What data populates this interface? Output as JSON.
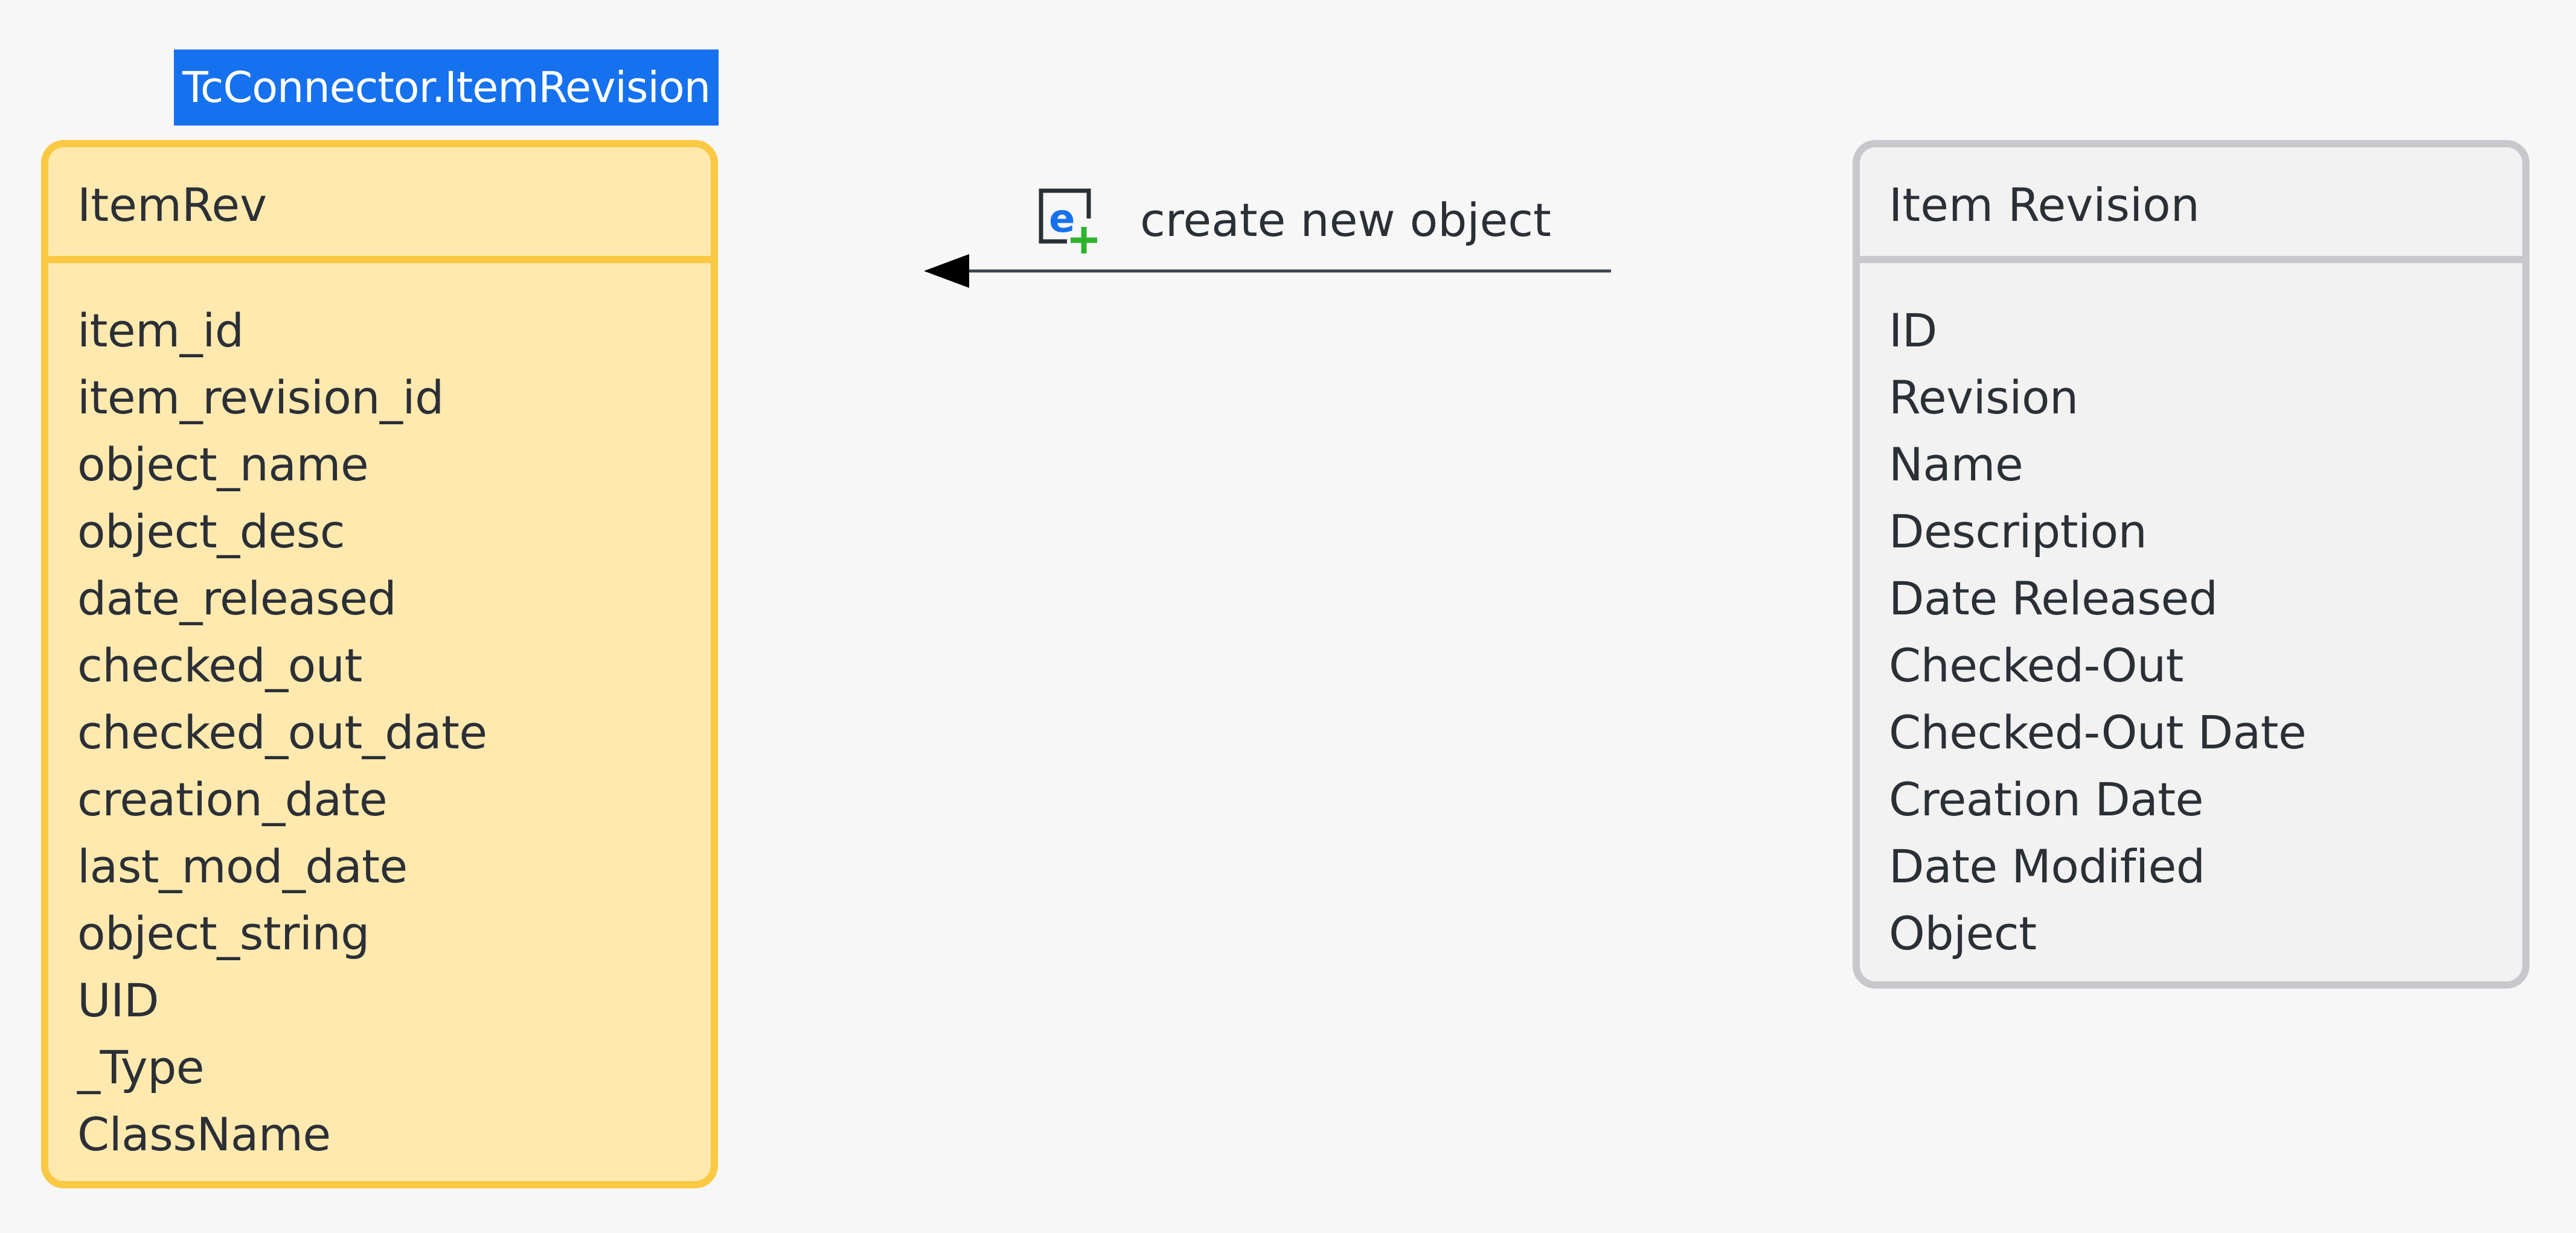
{
  "source_entity": {
    "tag": "TcConnector.ItemRevision",
    "title": "ItemRev",
    "fields": [
      "item_id",
      "item_revision_id",
      "object_name",
      "object_desc",
      "date_released",
      "checked_out",
      "checked_out_date",
      "creation_date",
      "last_mod_date",
      "object_string",
      "UID",
      "_Type",
      "ClassName"
    ]
  },
  "target_entity": {
    "title": "Item Revision",
    "fields": [
      "ID",
      "Revision",
      "Name",
      "Description",
      "Date Released",
      "Checked-Out",
      "Checked-Out Date",
      "Creation Date",
      "Date Modified",
      "Object"
    ]
  },
  "connector": {
    "label": "create new object",
    "icon": "create-object-icon",
    "direction": "right-to-left"
  },
  "colors": {
    "tag_background": "#1671ee",
    "source_fill": "#ffe9ae",
    "source_border": "#fbc843",
    "target_fill": "#f2f2f2",
    "target_border": "#c7c7cc",
    "icon_plus": "#2eb32e",
    "icon_e": "#1671ee"
  }
}
